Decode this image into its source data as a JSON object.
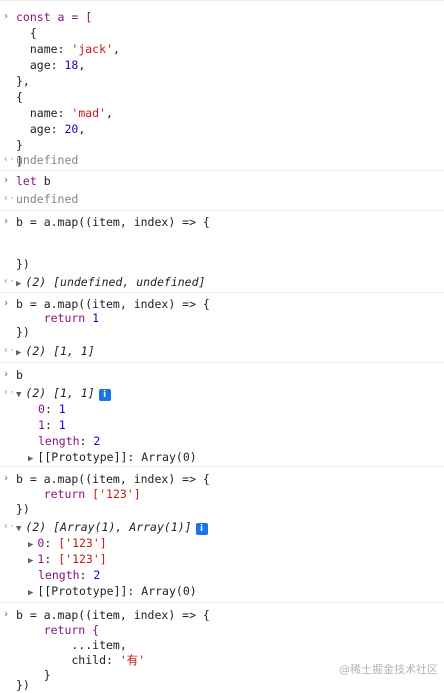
{
  "console": {
    "e1": {
      "l1": "const a = [",
      "l2": "  {",
      "l3a": "  name: ",
      "l3b": "'jack'",
      "l3c": ",",
      "l4a": "  age: ",
      "l4b": "18",
      "l4c": ",",
      "l5": "},",
      "l6": "{",
      "l7a": "  name: ",
      "l7b": "'mad'",
      "l7c": ",",
      "l8a": "  age: ",
      "l8b": "20",
      "l8c": ",",
      "l9": "}",
      "l10": "]",
      "result": "undefined"
    },
    "e2": {
      "l1": "let b",
      "result": "undefined"
    },
    "e3": {
      "l1": "b = a.map((item, index) => {",
      "l2": "})",
      "result": "(2) [undefined, undefined]"
    },
    "e4": {
      "l1": "b = a.map((item, index) => {",
      "l2a": "    return ",
      "l2b": "1",
      "l3": "})",
      "result": "(2) [1, 1]"
    },
    "e5": {
      "l1": "b",
      "result": "(2) [1, 1]",
      "info": "i",
      "p0k": "0",
      "p0v": "1",
      "p1k": "1",
      "p1v": "1",
      "plk": "length",
      "plv": "2",
      "proto": "[[Prototype]]: Array(0)"
    },
    "e6": {
      "l1": "b = a.map((item, index) => {",
      "l2a": "    return ",
      "l2b": "['123']",
      "l3": "})",
      "result": "(2) [Array(1), Array(1)]",
      "info": "i",
      "p0k": "0",
      "p0v": "['123']",
      "p1k": "1",
      "p1v": "['123']",
      "plk": "length",
      "plv": "2",
      "proto": "[[Prototype]]: Array(0)"
    },
    "e7": {
      "l1": "b = a.map((item, index) => {",
      "l2": "    return {",
      "l3": "        ...item,",
      "l4a": "        child: ",
      "l4b": "'有'",
      "l5": "    }",
      "l6": "})"
    }
  },
  "watermark": "@稀土掘金技术社区"
}
